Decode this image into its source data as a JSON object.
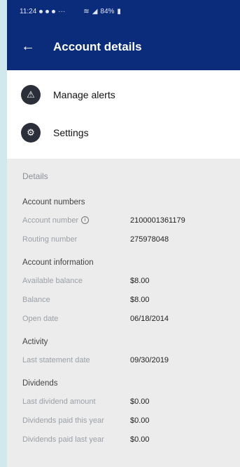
{
  "status_bar": {
    "time": "11:24",
    "battery": "84%"
  },
  "app_bar": {
    "title": "Account details"
  },
  "menu": [
    {
      "label": "Manage alerts",
      "icon": "warning-icon"
    },
    {
      "label": "Settings",
      "icon": "gear-icon"
    }
  ],
  "details": {
    "header": "Details",
    "account_numbers": {
      "title": "Account numbers",
      "rows": [
        {
          "label": "Account number",
          "value": "2100001361179"
        },
        {
          "label": "Routing number",
          "value": "275978048"
        }
      ]
    },
    "account_information": {
      "title": "Account information",
      "rows": [
        {
          "label": "Available balance",
          "value": "$8.00"
        },
        {
          "label": "Balance",
          "value": "$8.00"
        },
        {
          "label": "Open date",
          "value": "06/18/2014"
        }
      ]
    },
    "activity": {
      "title": "Activity",
      "rows": [
        {
          "label": "Last statement date",
          "value": "09/30/2019"
        }
      ]
    },
    "dividends": {
      "title": "Dividends",
      "rows": [
        {
          "label": "Last dividend amount",
          "value": "$0.00"
        },
        {
          "label": "Dividends paid this year",
          "value": "$0.00"
        },
        {
          "label": "Dividends paid last year",
          "value": "$0.00"
        }
      ]
    }
  }
}
